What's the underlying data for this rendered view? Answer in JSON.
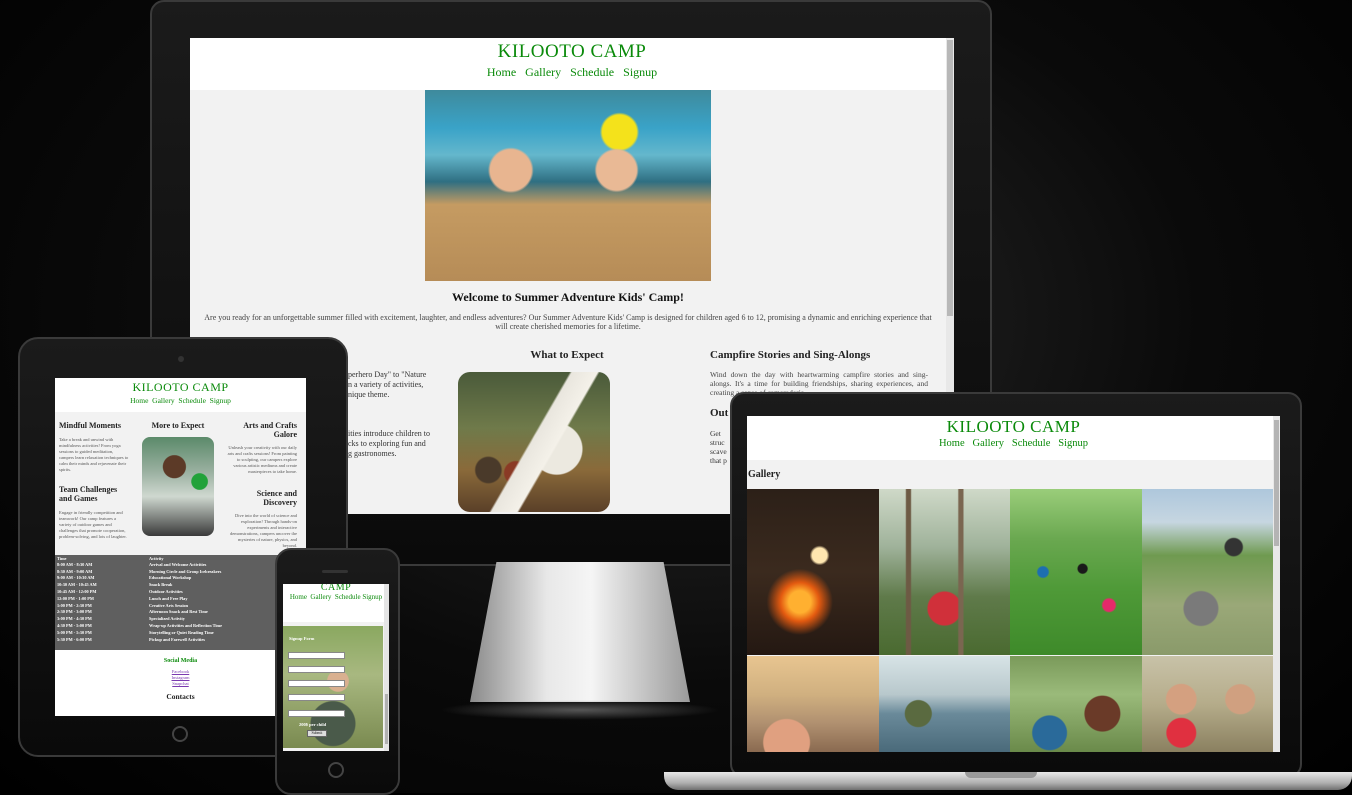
{
  "site": {
    "title": "KILOOTO CAMP",
    "nav": [
      "Home",
      "Gallery",
      "Schedule",
      "Signup"
    ]
  },
  "desktop": {
    "welcome_heading": "Welcome to Summer Adventure Kids' Camp!",
    "welcome_text": "Are you ready for an unforgettable summer filled with excitement, laughter, and endless adventures? Our Summer Adventure Kids' Camp is designed for children aged 6 to 12, promising a dynamic and enriching experience that will create cherished memories for a lifetime.",
    "left_fragment_1": "perhero Day\" to \"Nature",
    "left_fragment_2": "n a variety of activities,",
    "left_fragment_3": "nique theme.",
    "left_fragment_4": "ities introduce children to",
    "left_fragment_5": "cks to exploring fun and",
    "left_fragment_6": "g gastronomes.",
    "center_heading": "What to Expect",
    "right_heading_1": "Campfire Stories and Sing-Alongs",
    "right_text_1": "Wind down the day with heartwarming campfire stories and sing-alongs. It's a time for building friendships, sharing experiences, and creating a sense of camaraderie.",
    "right_heading_2": "Out",
    "right_frag_1": "Get",
    "right_frag_2": "struc",
    "right_frag_3": "scave",
    "right_frag_4": "that p"
  },
  "tablet": {
    "col1_heading_1": "Mindful Moments",
    "col1_text_1": "Take a break and unwind with mindfulness activities! From yoga sessions to guided meditation, campers learn relaxation techniques to calm their minds and rejuvenate their spirits.",
    "col1_heading_2": "Team Challenges and Games",
    "col1_text_2": "Engage in friendly competition and teamwork! Our camp features a variety of outdoor games and challenges that promote cooperation, problem-solving, and lots of laughter.",
    "col2_heading": "More to Expect",
    "col3_heading_1": "Arts and Crafts Galore",
    "col3_text_1": "Unleash your creativity with our daily arts and crafts sessions! From painting to sculpting, our campers explore various artistic mediums and create masterpieces to take home.",
    "col3_heading_2": "Science and Discovery",
    "col3_text_2": "Dive into the world of science and exploration! Through hands-on experiments and interactive demonstrations, campers uncover the mysteries of nature, physics, and beyond.",
    "schedule_headers": [
      "Time",
      "Activity"
    ],
    "schedule": [
      [
        "8:00 AM - 8:30 AM",
        "Arrival and Welcome Activities"
      ],
      [
        "8:30 AM - 9:00 AM",
        "Morning Circle and Group Icebreakers"
      ],
      [
        "9:00 AM - 10:30 AM",
        "Educational Workshop"
      ],
      [
        "10:30 AM - 10:45 AM",
        "Snack Break"
      ],
      [
        "10:45 AM - 12:00 PM",
        "Outdoor Activities"
      ],
      [
        "12:00 PM - 1:00 PM",
        "Lunch and Free Play"
      ],
      [
        "1:00 PM - 2:30 PM",
        "Creative Arts Session"
      ],
      [
        "2:30 PM - 3:00 PM",
        "Afternoon Snack and Rest Time"
      ],
      [
        "3:00 PM - 4:30 PM",
        "Specialized Activity"
      ],
      [
        "4:30 PM - 5:00 PM",
        "Wrap-up Activities and Reflection Time"
      ],
      [
        "5:00 PM - 5:30 PM",
        "Storytelling or Quiet Reading Time"
      ],
      [
        "5:30 PM - 6:00 PM",
        "Pickup and Farewell Activities"
      ]
    ],
    "social_heading": "Social Media",
    "social_links": [
      "Facebook",
      "Instagram",
      "Snapchat"
    ],
    "contacts_heading": "Contacts"
  },
  "phone": {
    "title_fragment": "CAMP",
    "form_heading": "Signup Form",
    "price": "200$ per child",
    "submit_label": "Submit"
  },
  "laptop": {
    "gallery_heading": "Gallery"
  },
  "colors": {
    "brand_green": "#0a8a0a",
    "page_bg": "#f2f2f2",
    "table_bg": "#5f5f5f"
  }
}
